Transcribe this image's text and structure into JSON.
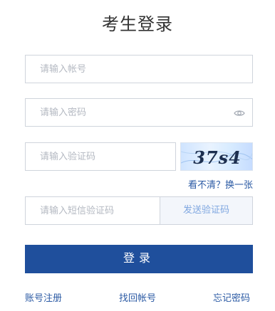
{
  "title": "考生登录",
  "account": {
    "placeholder": "请输入帐号",
    "value": ""
  },
  "password": {
    "placeholder": "请输入密码",
    "value": "",
    "toggle_icon": "eye-icon"
  },
  "captcha": {
    "placeholder": "请输入验证码",
    "value": "",
    "image_text": "37s4",
    "refresh_label": "看不清？换一张"
  },
  "sms": {
    "placeholder": "请输入短信验证码",
    "value": "",
    "send_label": "发送验证码"
  },
  "login_label": "登录",
  "links": {
    "register": "账号注册",
    "find_account": "找回帐号",
    "forgot_password": "忘记密码"
  },
  "colors": {
    "primary": "#1f4f9c",
    "link": "#2b5aa4",
    "sms_text": "#7fa7e0",
    "border": "#cfd4dc"
  }
}
